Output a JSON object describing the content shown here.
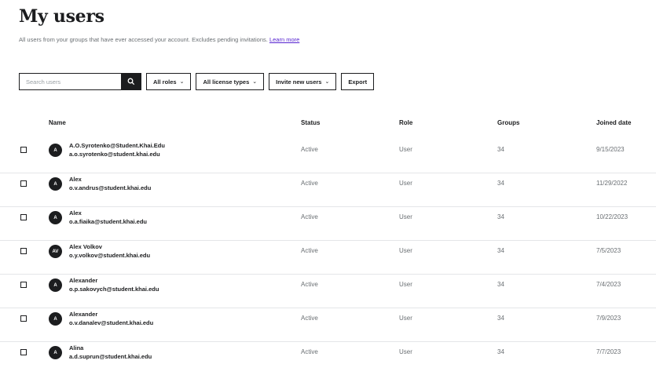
{
  "page": {
    "title": "My users",
    "subtitle": "All users from your groups that have ever accessed your account. Excludes pending invitations.",
    "learn_more": "Learn more"
  },
  "toolbar": {
    "search_placeholder": "Search users",
    "all_roles": "All roles",
    "all_license_types": "All license types",
    "invite_new_users": "Invite new users",
    "export": "Export"
  },
  "table": {
    "headers": {
      "name": "Name",
      "status": "Status",
      "role": "Role",
      "groups": "Groups",
      "joined": "Joined date"
    },
    "rows": [
      {
        "initials": "A",
        "name": "A.O.Syrotenko@Student.Khai.Edu",
        "email": "a.o.syrotenko@student.khai.edu",
        "status": "Active",
        "role": "User",
        "groups": "34",
        "joined": "9/15/2023"
      },
      {
        "initials": "A",
        "name": "Alex",
        "email": "o.v.andrus@student.khai.edu",
        "status": "Active",
        "role": "User",
        "groups": "34",
        "joined": "11/29/2022"
      },
      {
        "initials": "A",
        "name": "Alex",
        "email": "o.a.fiaika@student.khai.edu",
        "status": "Active",
        "role": "User",
        "groups": "34",
        "joined": "10/22/2023"
      },
      {
        "initials": "AV",
        "name": "Alex Volkov",
        "email": "o.y.volkov@student.khai.edu",
        "status": "Active",
        "role": "User",
        "groups": "34",
        "joined": "7/5/2023"
      },
      {
        "initials": "A",
        "name": "Alexander",
        "email": "o.p.sakovych@student.khai.edu",
        "status": "Active",
        "role": "User",
        "groups": "34",
        "joined": "7/4/2023"
      },
      {
        "initials": "A",
        "name": "Alexander",
        "email": "o.v.danalev@student.khai.edu",
        "status": "Active",
        "role": "User",
        "groups": "34",
        "joined": "7/9/2023"
      },
      {
        "initials": "A",
        "name": "Alina",
        "email": "a.d.suprun@student.khai.edu",
        "status": "Active",
        "role": "User",
        "groups": "34",
        "joined": "7/7/2023"
      }
    ]
  },
  "icons": {
    "search": "search-icon",
    "dropdown": "chevron-down-icon"
  },
  "colors": {
    "primary": "#1c1d1f",
    "link": "#5624d0",
    "muted": "#6a6f73",
    "divider": "#e4e6e8"
  }
}
